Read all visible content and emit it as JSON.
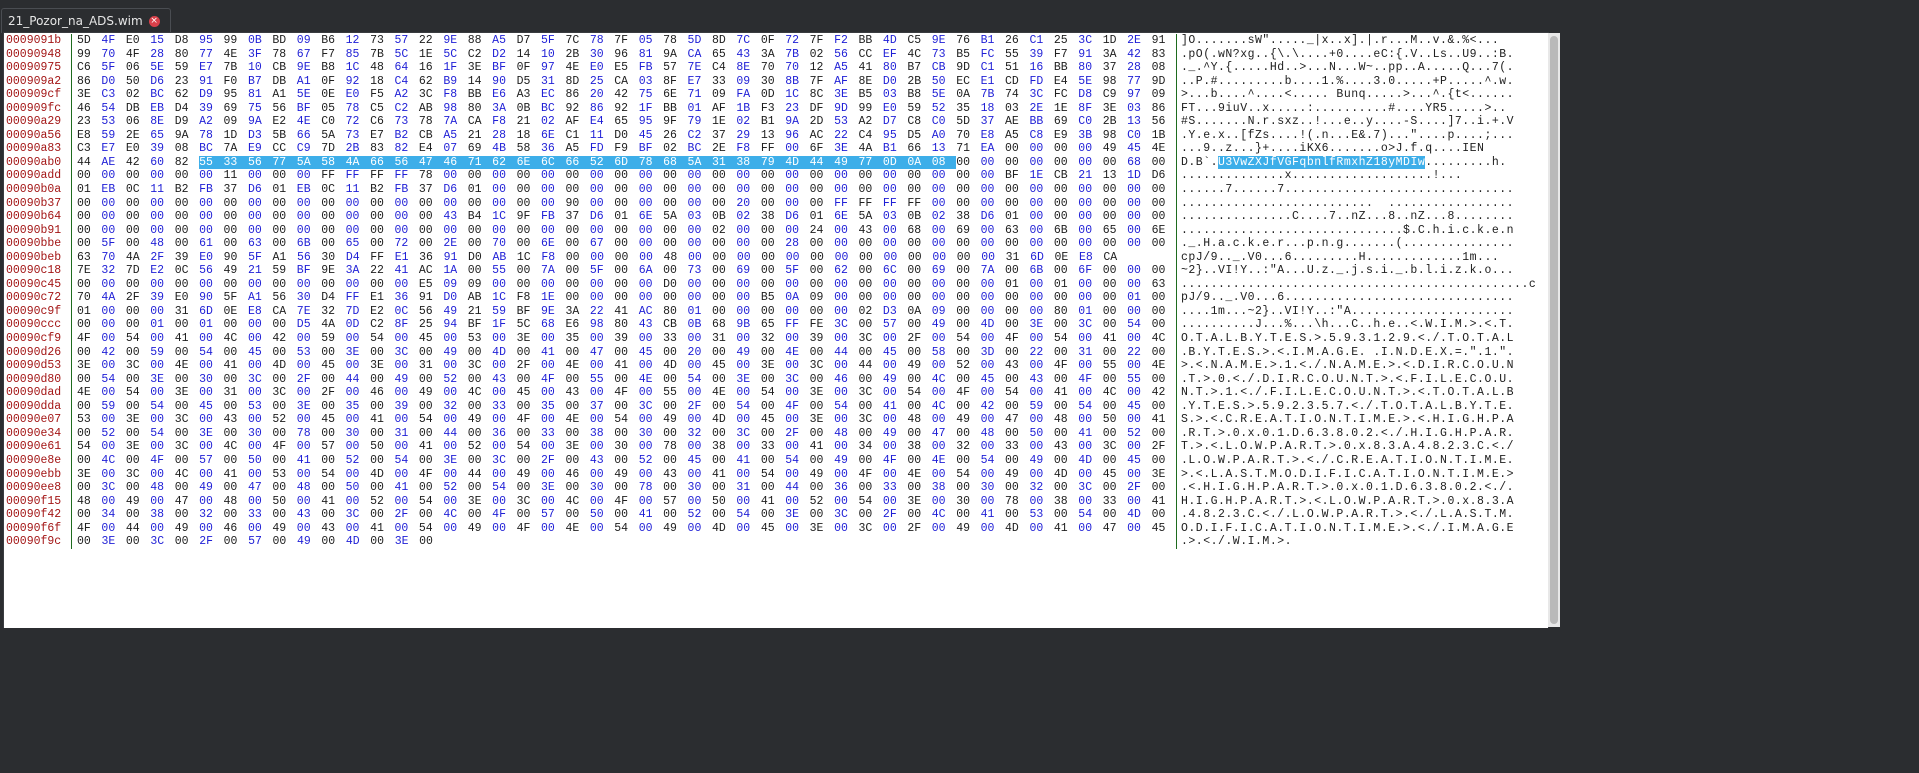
{
  "tab": {
    "title": "21_Pozor_na_ADS.wim",
    "close_icon": "close-icon"
  },
  "colors": {
    "offset": "#a31515",
    "odd_byte": "#1f1fd6",
    "even_byte": "#202020",
    "selection": "#3daee9",
    "divider": "#1e6b1e"
  },
  "selection": {
    "row": 9,
    "start": 5,
    "end": 36,
    "ascii_text": "U3VwZXJfVGFqbnlfRmxhZ18yMDIw"
  },
  "rows": [
    {
      "offset": "0009091b",
      "bytes": "5D 4F E0 15 D8 95 99 0B BD 09 B6 12 73 57 22 9E 88 A5 D7 5F 7C 78 7F 05 78 5D 8D 7C 0F 72 7F F2 BB 4D C5 9E 76 B1 26 C1 25 3C 1D 2E 91",
      "ascii": "]O.......sW\"....._|x..x].|.r...M..v.&.%<..."
    },
    {
      "offset": "00090948",
      "bytes": "99 70 4F 28 80 77 4E 3F 78 67 F7 85 7B 5C 1E 5C C2 D2 14 10 2B 30 96 81 9A CA 65 43 3A 7B 02 56 CC EF 4C 73 B5 FC 55 39 F7 91 3A 42 83",
      "ascii": ".pO(.wN?xg..{\\.\\....+0....eC:{.V..Ls..U9..:B."
    },
    {
      "offset": "00090975",
      "bytes": "C6 5F 06 5E 59 E7 7B 10 CB 9E B8 1C 48 64 16 1F 3E BF 0F 97 4E E0 E5 FB 57 7E C4 8E 70 70 12 A5 41 80 B7 CB 9D C1 51 16 BB 80 37 28 08",
      "ascii": "._.^Y.{.....Hd..>...N...W~..pp..A.....Q...7(."
    },
    {
      "offset": "000909a2",
      "bytes": "86 D0 50 D6 23 91 F0 B7 DB A1 0F 92 18 C4 62 B9 14 90 D5 31 8D 25 CA 03 8F E7 33 09 30 8B 7F AF 8E D0 2B 50 EC E1 CD FD E4 5E 98 77 9D",
      "ascii": "..P.#.........b....1.%....3.0.....+P.....^.w."
    },
    {
      "offset": "000909cf",
      "bytes": "3E C3 02 BC 62 D9 95 81 A1 5E 0E E0 F5 A2 3C F8 BB E6 A3 EC 86 20 42 75 6E 71 09 FA 0D 1C 8C 3E B5 03 B8 5E 0A 7B 74 3C FC D8 C9 97 09",
      "ascii": ">...b....^....<..... Bunq.....>...^.{t<......"
    },
    {
      "offset": "000909fc",
      "bytes": "46 54 DB EB D4 39 69 75 56 BF 05 78 C5 C2 AB 98 80 3A 0B BC 92 86 92 1F BB 01 AF 1B F3 23 DF 9D 99 E0 59 52 35 18 03 2E 1E 8F 3E 03 86",
      "ascii": "FT...9iuV..x.....:..........#....YR5.....>.."
    },
    {
      "offset": "00090a29",
      "bytes": "23 53 06 8E D9 A2 09 9A E2 4E C0 72 C6 73 78 7A CA F8 21 02 AF E4 65 95 9F 79 1E 02 B1 9A 2D 53 A2 D7 C8 C0 5D 37 AE BB 69 C0 2B 13 56",
      "ascii": "#S.......N.r.sxz..!...e..y....-S....]7..i.+.V"
    },
    {
      "offset": "00090a56",
      "bytes": "E8 59 2E 65 9A 78 1D D3 5B 66 5A 73 E7 B2 CB A5 21 28 18 6E C1 11 D0 45 26 C2 37 29 13 96 AC 22 C4 95 D5 A0 70 E8 A5 C8 E9 3B 98 C0 1B",
      "ascii": ".Y.e.x..[fZs....!(.n...E&.7)...\"....p....;..."
    },
    {
      "offset": "00090a83",
      "bytes": "C3 E7 E0 39 08 BC 7A E9 CC C9 7D 2B 83 82 E4 07 69 4B 58 36 A5 FD F9 BF 02 BC 2E F8 FF 00 6F 3E 4A B1 66 13 71 EA 00 00 00 00 49 45 4E",
      "ascii": "...9..z...}+....iKX6.......o>J.f.q....IEN"
    },
    {
      "offset": "00090ab0",
      "bytes": "44 AE 42 60 82 55 33 56 77 5A 58 4A 66 56 47 46 71 62 6E 6C 66 52 6D 78 68 5A 31 38 79 4D 44 49 77 0D 0A 08 00 00 00 00 00 00 00 68 00",
      "ascii": "D.B`.U3VwZXJfVGFqbnlfRmxhZ18yMDIw.........h."
    },
    {
      "offset": "00090add",
      "bytes": "00 00 00 00 00 00 11 00 00 00 FF FF FF FF 78 00 00 00 00 00 00 00 00 00 00 00 00 00 00 00 00 00 00 00 00 00 00 00 BF 1E CB 21 13 1D D6",
      "ascii": "..............x...................!..."
    },
    {
      "offset": "00090b0a",
      "bytes": "01 EB 0C 11 B2 FB 37 D6 01 EB 0C 11 B2 FB 37 D6 01 00 00 00 00 00 00 00 00 00 00 00 00 00 00 00 00 00 00 00 00 00 00 00 00 00 00 00 00",
      "ascii": "......7......7..............................."
    },
    {
      "offset": "00090b37",
      "bytes": "00 00 00 00 00 00 00 00 00 00 00 00 00 00 00 00 00 00 00 00 90 00 00 00 00 00 00 20 00 00 00 FF FF FF FF 00 00 00 00 00 00 00 00 00 00",
      "ascii": "..........................  ................."
    },
    {
      "offset": "00090b64",
      "bytes": "00 00 00 00 00 00 00 00 00 00 00 00 00 00 00 43 B4 1C 9F FB 37 D6 01 6E 5A 03 0B 02 38 D6 01 6E 5A 03 0B 02 38 D6 01 00 00 00 00 00 00",
      "ascii": "...............C....7..nZ...8..nZ...8........"
    },
    {
      "offset": "00090b91",
      "bytes": "00 00 00 00 00 00 00 00 00 00 00 00 00 00 00 00 00 00 00 00 00 00 00 00 00 00 02 00 00 00 24 00 43 00 68 00 69 00 63 00 6B 00 65 00 6E",
      "ascii": "..............................$.C.h.i.c.k.e.n"
    },
    {
      "offset": "00090bbe",
      "bytes": "00 5F 00 48 00 61 00 63 00 6B 00 65 00 72 00 2E 00 70 00 6E 00 67 00 00 00 00 00 00 00 28 00 00 00 00 00 00 00 00 00 00 00 00 00 00 00",
      "ascii": "._.H.a.c.k.e.r...p.n.g.......(..............."
    },
    {
      "offset": "00090beb",
      "bytes": "63 70 4A 2F 39 E0 90 5F A1 56 30 D4 FF E1 36 91 D0 AB 1C F8 00 00 00 00 48 00 00 00 00 00 00 00 00 00 00 00 00 00 31 6D 0E E8 CA",
      "ascii": "cpJ/9.._.V0...6.........H.............1m..."
    },
    {
      "offset": "00090c18",
      "bytes": "7E 32 7D E2 0C 56 49 21 59 BF 9E 3A 22 41 AC 1A 00 55 00 7A 00 5F 00 6A 00 73 00 69 00 5F 00 62 00 6C 00 69 00 7A 00 6B 00 6F 00 00 00",
      "ascii": "~2}..VI!Y..:\"A...U.z._.j.s.i._.b.l.i.z.k.o..."
    },
    {
      "offset": "00090c45",
      "bytes": "00 00 00 00 00 00 00 00 00 00 00 00 00 00 E5 09 09 00 00 00 00 00 00 00 D0 00 00 00 00 00 00 00 00 00 00 00 00 00 01 00 01 00 00 00 63",
      "ascii": "...............................................c"
    },
    {
      "offset": "00090c72",
      "bytes": "70 4A 2F 39 E0 90 5F A1 56 30 D4 FF E1 36 91 D0 AB 1C F8 1E 00 00 00 00 00 00 00 00 B5 0A 09 00 00 00 00 00 00 00 00 00 00 00 00 01 00",
      "ascii": "pJ/9.._.V0...6..............................."
    },
    {
      "offset": "00090c9f",
      "bytes": "01 00 00 00 31 6D 0E E8 CA 7E 32 7D E2 0C 56 49 21 59 BF 9E 3A 22 41 AC 80 01 00 00 00 00 00 00 02 D3 0A 09 00 00 00 00 80 01 00 00 00",
      "ascii": "....1m...~2}..VI!Y..:\"A......................"
    },
    {
      "offset": "00090ccc",
      "bytes": "00 00 00 01 00 01 00 00 00 D5 4A 0D C2 8F 25 94 BF 1F 5C 68 E6 98 80 43 CB 0B 68 9B 65 FF FE 3C 00 57 00 49 00 4D 00 3E 00 3C 00 54 00",
      "ascii": "..........J...%...\\h...C..h.e..<.W.I.M.>.<.T."
    },
    {
      "offset": "00090cf9",
      "bytes": "4F 00 54 00 41 00 4C 00 42 00 59 00 54 00 45 00 53 00 3E 00 35 00 39 00 33 00 31 00 32 00 39 00 3C 00 2F 00 54 00 4F 00 54 00 41 00 4C",
      "ascii": "O.T.A.L.B.Y.T.E.S.>.5.9.3.1.2.9.<./.T.O.T.A.L"
    },
    {
      "offset": "00090d26",
      "bytes": "00 42 00 59 00 54 00 45 00 53 00 3E 00 3C 00 49 00 4D 00 41 00 47 00 45 00 20 00 49 00 4E 00 44 00 45 00 58 00 3D 00 22 00 31 00 22 00",
      "ascii": ".B.Y.T.E.S.>.<.I.M.A.G.E. .I.N.D.E.X.=.\".1.\"."
    },
    {
      "offset": "00090d53",
      "bytes": "3E 00 3C 00 4E 00 41 00 4D 00 45 00 3E 00 31 00 3C 00 2F 00 4E 00 41 00 4D 00 45 00 3E 00 3C 00 44 00 49 00 52 00 43 00 4F 00 55 00 4E",
      "ascii": ">.<.N.A.M.E.>.1.<./.N.A.M.E.>.<.D.I.R.C.O.U.N"
    },
    {
      "offset": "00090d80",
      "bytes": "00 54 00 3E 00 30 00 3C 00 2F 00 44 00 49 00 52 00 43 00 4F 00 55 00 4E 00 54 00 3E 00 3C 00 46 00 49 00 4C 00 45 00 43 00 4F 00 55 00",
      "ascii": ".T.>.0.<./.D.I.R.C.O.U.N.T.>.<.F.I.L.E.C.O.U."
    },
    {
      "offset": "00090dad",
      "bytes": "4E 00 54 00 3E 00 31 00 3C 00 2F 00 46 00 49 00 4C 00 45 00 43 00 4F 00 55 00 4E 00 54 00 3E 00 3C 00 54 00 4F 00 54 00 41 00 4C 00 42",
      "ascii": "N.T.>.1.<./.F.I.L.E.C.O.U.N.T.>.<.T.O.T.A.L.B"
    },
    {
      "offset": "00090dda",
      "bytes": "00 59 00 54 00 45 00 53 00 3E 00 35 00 39 00 32 00 33 00 35 00 37 00 3C 00 2F 00 54 00 4F 00 54 00 41 00 4C 00 42 00 59 00 54 00 45 00",
      "ascii": ".Y.T.E.S.>.5.9.2.3.5.7.<./.T.O.T.A.L.B.Y.T.E."
    },
    {
      "offset": "00090e07",
      "bytes": "53 00 3E 00 3C 00 43 00 52 00 45 00 41 00 54 00 49 00 4F 00 4E 00 54 00 49 00 4D 00 45 00 3E 00 3C 00 48 00 49 00 47 00 48 00 50 00 41",
      "ascii": "S.>.<.C.R.E.A.T.I.O.N.T.I.M.E.>.<.H.I.G.H.P.A"
    },
    {
      "offset": "00090e34",
      "bytes": "00 52 00 54 00 3E 00 30 00 78 00 30 00 31 00 44 00 36 00 33 00 38 00 30 00 32 00 3C 00 2F 00 48 00 49 00 47 00 48 00 50 00 41 00 52 00",
      "ascii": ".R.T.>.0.x.0.1.D.6.3.8.0.2.<./.H.I.G.H.P.A.R."
    },
    {
      "offset": "00090e61",
      "bytes": "54 00 3E 00 3C 00 4C 00 4F 00 57 00 50 00 41 00 52 00 54 00 3E 00 30 00 78 00 38 00 33 00 41 00 34 00 38 00 32 00 33 00 43 00 3C 00 2F",
      "ascii": "T.>.<.L.O.W.P.A.R.T.>.0.x.8.3.A.4.8.2.3.C.<./"
    },
    {
      "offset": "00090e8e",
      "bytes": "00 4C 00 4F 00 57 00 50 00 41 00 52 00 54 00 3E 00 3C 00 2F 00 43 00 52 00 45 00 41 00 54 00 49 00 4F 00 4E 00 54 00 49 00 4D 00 45 00",
      "ascii": ".L.O.W.P.A.R.T.>.<./.C.R.E.A.T.I.O.N.T.I.M.E."
    },
    {
      "offset": "00090ebb",
      "bytes": "3E 00 3C 00 4C 00 41 00 53 00 54 00 4D 00 4F 00 44 00 49 00 46 00 49 00 43 00 41 00 54 00 49 00 4F 00 4E 00 54 00 49 00 4D 00 45 00 3E",
      "ascii": ">.<.L.A.S.T.M.O.D.I.F.I.C.A.T.I.O.N.T.I.M.E.>"
    },
    {
      "offset": "00090ee8",
      "bytes": "00 3C 00 48 00 49 00 47 00 48 00 50 00 41 00 52 00 54 00 3E 00 30 00 78 00 30 00 31 00 44 00 36 00 33 00 38 00 30 00 32 00 3C 00 2F 00",
      "ascii": ".<.H.I.G.H.P.A.R.T.>.0.x.0.1.D.6.3.8.0.2.<./."
    },
    {
      "offset": "00090f15",
      "bytes": "48 00 49 00 47 00 48 00 50 00 41 00 52 00 54 00 3E 00 3C 00 4C 00 4F 00 57 00 50 00 41 00 52 00 54 00 3E 00 30 00 78 00 38 00 33 00 41",
      "ascii": "H.I.G.H.P.A.R.T.>.<.L.O.W.P.A.R.T.>.0.x.8.3.A"
    },
    {
      "offset": "00090f42",
      "bytes": "00 34 00 38 00 32 00 33 00 43 00 3C 00 2F 00 4C 00 4F 00 57 00 50 00 41 00 52 00 54 00 3E 00 3C 00 2F 00 4C 00 41 00 53 00 54 00 4D 00",
      "ascii": ".4.8.2.3.C.<./.L.O.W.P.A.R.T.>.<./.L.A.S.T.M."
    },
    {
      "offset": "00090f6f",
      "bytes": "4F 00 44 00 49 00 46 00 49 00 43 00 41 00 54 00 49 00 4F 00 4E 00 54 00 49 00 4D 00 45 00 3E 00 3C 00 2F 00 49 00 4D 00 41 00 47 00 45",
      "ascii": "O.D.I.F.I.C.A.T.I.O.N.T.I.M.E.>.<./.I.M.A.G.E"
    },
    {
      "offset": "00090f9c",
      "bytes": "00 3E 00 3C 00 2F 00 57 00 49 00 4D 00 3E 00",
      "ascii": ".>.<./.W.I.M.>."
    }
  ]
}
